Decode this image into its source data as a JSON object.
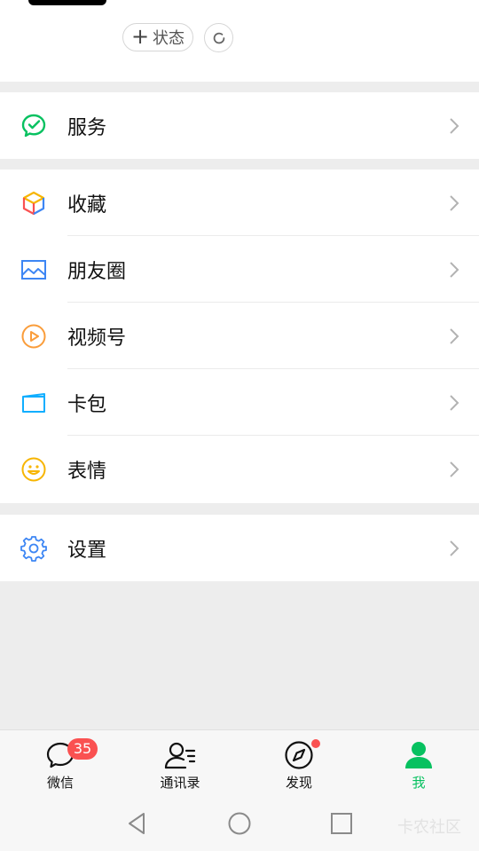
{
  "header": {
    "status_plus": "+",
    "status_label": "状态"
  },
  "menu": {
    "services": {
      "label": "服务",
      "color": "#07c160",
      "icon": "services-icon"
    },
    "items": [
      {
        "label": "收藏",
        "icon": "favorites-icon"
      },
      {
        "label": "朋友圈",
        "icon": "moments-icon"
      },
      {
        "label": "视频号",
        "icon": "channels-icon"
      },
      {
        "label": "卡包",
        "icon": "card-wallet-icon"
      },
      {
        "label": "表情",
        "icon": "stickers-icon"
      }
    ],
    "settings": {
      "label": "设置",
      "icon": "settings-icon"
    }
  },
  "tabbar": {
    "tabs": [
      {
        "label": "微信",
        "badge": "35",
        "icon": "chats-icon"
      },
      {
        "label": "通讯录",
        "icon": "contacts-icon"
      },
      {
        "label": "发现",
        "icon": "discover-icon",
        "dot": true
      },
      {
        "label": "我",
        "icon": "me-icon",
        "active": true
      }
    ],
    "active_color": "#07c160",
    "badge_color": "#fa5151"
  },
  "system_nav": {
    "watermark": "卡农社区"
  }
}
